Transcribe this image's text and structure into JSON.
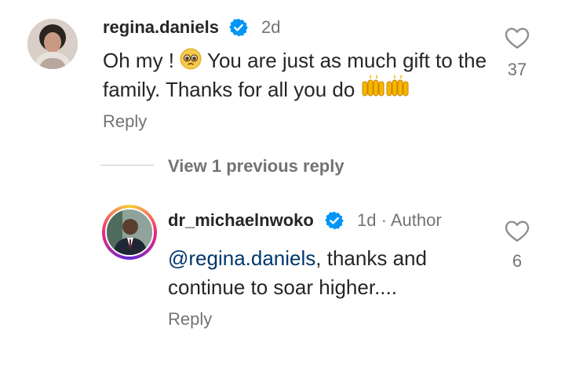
{
  "comment": {
    "username": "regina.daniels",
    "time": "2d",
    "text_before": "Oh my ! ",
    "text_after": " You are just as much gift to the family. Thanks for all you do ",
    "pleading_emoji": "pleading-face-emoji",
    "hands_emoji": "raising-hands-emoji",
    "reply_label": "Reply",
    "likes": "37"
  },
  "view_replies": {
    "label": "View 1 previous reply"
  },
  "reply": {
    "username": "dr_michaelnwoko",
    "time": "1d",
    "separator": "·",
    "author_badge": "Author",
    "mention": "@regina.daniels",
    "text": ", thanks and continue to soar higher....",
    "reply_label": "Reply",
    "likes": "6"
  },
  "colors": {
    "verified_blue": "#0095f6",
    "text_primary": "#262626",
    "text_secondary": "#737373",
    "mention": "#00376b"
  },
  "icons": [
    "verified-badge-icon",
    "heart-icon"
  ]
}
